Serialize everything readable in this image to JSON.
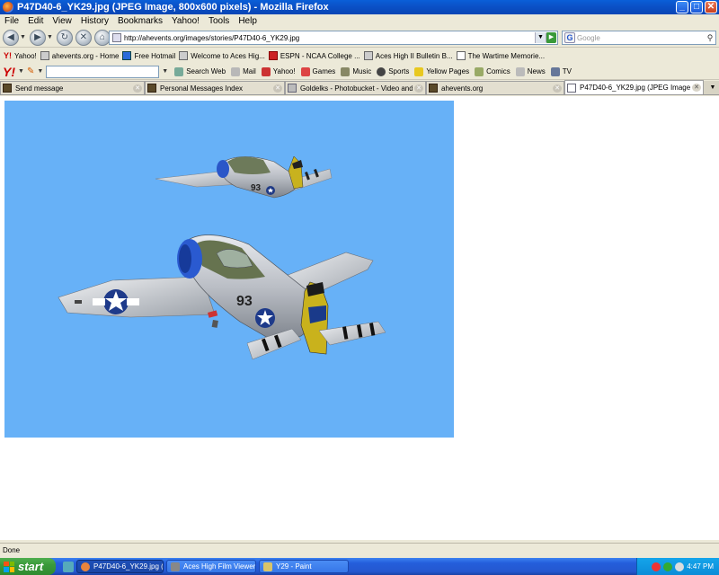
{
  "window": {
    "title": "P47D40-6_YK29.jpg (JPEG Image, 800x600 pixels) - Mozilla Firefox",
    "minimize": "_",
    "maximize": "□",
    "close": "✕"
  },
  "menu": [
    "File",
    "Edit",
    "View",
    "History",
    "Bookmarks",
    "Yahoo!",
    "Tools",
    "Help"
  ],
  "nav": {
    "url": "http://ahevents.org/images/stories/P47D40-6_YK29.jpg",
    "search_placeholder": "Google"
  },
  "bookmarks": [
    {
      "label": "Yahoo!",
      "icon": "yahoo-icon"
    },
    {
      "label": "ahevents.org - Home",
      "icon": "ahevents-icon"
    },
    {
      "label": "Free Hotmail",
      "icon": "hotmail-icon"
    },
    {
      "label": "Welcome to Aces Hig...",
      "icon": "acehigh-icon"
    },
    {
      "label": "ESPN - NCAA College ...",
      "icon": "espn-icon"
    },
    {
      "label": "Aces High II Bulletin B...",
      "icon": "acehigh-icon"
    },
    {
      "label": "The Wartime Memorie...",
      "icon": "page-icon"
    }
  ],
  "yahoo_toolbar": {
    "logo": "Y!",
    "search_button": "Search Web",
    "items": [
      "Mail",
      "Yahoo!",
      "Games",
      "Music",
      "Sports",
      "Yellow Pages",
      "Comics",
      "News",
      "TV"
    ]
  },
  "tabs": [
    {
      "label": "Send message",
      "active": false
    },
    {
      "label": "Personal Messages Index",
      "active": false
    },
    {
      "label": "Goldelks - Photobucket - Video and Im...",
      "active": false
    },
    {
      "label": "ahevents.org",
      "active": false
    },
    {
      "label": "P47D40-6_YK29.jpg (JPEG Image...",
      "active": true
    }
  ],
  "image": {
    "sky_color": "#67b1f7",
    "plane_codes": [
      "93",
      "93"
    ]
  },
  "status": "Done",
  "taskbar": {
    "start_label": "start",
    "tasks": [
      {
        "label": "P47D40-6_YK29.jpg (...",
        "active": true
      },
      {
        "label": "Aces High Film Viewer",
        "active": false
      },
      {
        "label": "Y29 - Paint",
        "active": false
      }
    ],
    "clock": "4:47 PM"
  }
}
